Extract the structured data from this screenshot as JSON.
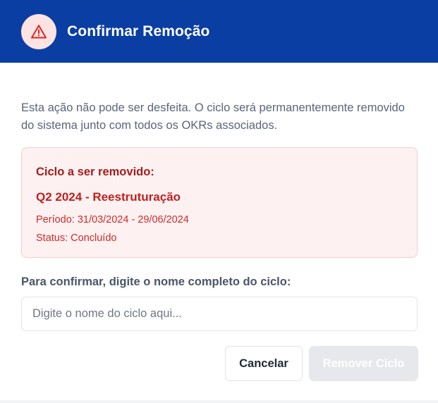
{
  "dialog": {
    "title": "Confirmar Remoção",
    "warning_icon": "warning-triangle-icon",
    "description": "Esta ação não pode ser desfeita. O ciclo será permanentemente removido do sistema junto com todos os OKRs associados."
  },
  "cycle_info": {
    "heading": "Ciclo a ser removido:",
    "name": "Q2 2024 - Reestruturação",
    "period": "Período: 31/03/2024 - 29/06/2024",
    "status": "Status: Concluído"
  },
  "confirm": {
    "label": "Para confirmar, digite o nome completo do ciclo:",
    "placeholder": "Digite o nome do ciclo aqui...",
    "value": ""
  },
  "actions": {
    "cancel_label": "Cancelar",
    "remove_label": "Remover Ciclo"
  },
  "colors": {
    "header_bg": "#0b3ea3",
    "warning_accent": "#dc2626",
    "info_bg": "#fdf1f1",
    "disabled_button_bg": "#e6e8ec"
  }
}
